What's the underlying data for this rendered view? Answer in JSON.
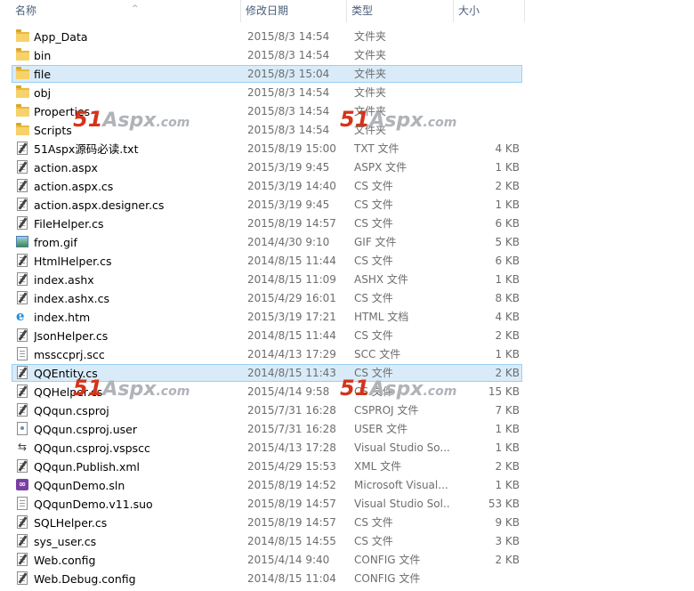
{
  "columns": {
    "name": "名称",
    "date": "修改日期",
    "type": "类型",
    "size": "大小"
  },
  "watermark": {
    "num": "51",
    "txt": "Aspx",
    "com": ".com"
  },
  "rows": [
    {
      "name": "App_Data",
      "date": "2015/8/3 14:54",
      "type": "文件夹",
      "size": "",
      "icon": "folder-icon",
      "selected": false
    },
    {
      "name": "bin",
      "date": "2015/8/3 14:54",
      "type": "文件夹",
      "size": "",
      "icon": "folder-icon",
      "selected": false
    },
    {
      "name": "file",
      "date": "2015/8/3 15:04",
      "type": "文件夹",
      "size": "",
      "icon": "folder-icon",
      "selected": true
    },
    {
      "name": "obj",
      "date": "2015/8/3 14:54",
      "type": "文件夹",
      "size": "",
      "icon": "folder-icon",
      "selected": false
    },
    {
      "name": "Properties",
      "date": "2015/8/3 14:54",
      "type": "文件夹",
      "size": "",
      "icon": "folder-icon",
      "selected": false
    },
    {
      "name": "Scripts",
      "date": "2015/8/3 14:54",
      "type": "文件夹",
      "size": "",
      "icon": "folder-icon",
      "selected": false
    },
    {
      "name": "51Aspx源码必读.txt",
      "date": "2015/8/19 15:00",
      "type": "TXT 文件",
      "size": "4 KB",
      "icon": "text-file-icon",
      "selected": false
    },
    {
      "name": "action.aspx",
      "date": "2015/3/19 9:45",
      "type": "ASPX 文件",
      "size": "1 KB",
      "icon": "text-file-icon",
      "selected": false
    },
    {
      "name": "action.aspx.cs",
      "date": "2015/3/19 14:40",
      "type": "CS 文件",
      "size": "2 KB",
      "icon": "text-file-icon",
      "selected": false
    },
    {
      "name": "action.aspx.designer.cs",
      "date": "2015/3/19 9:45",
      "type": "CS 文件",
      "size": "1 KB",
      "icon": "text-file-icon",
      "selected": false
    },
    {
      "name": "FileHelper.cs",
      "date": "2015/8/19 14:57",
      "type": "CS 文件",
      "size": "6 KB",
      "icon": "text-file-icon",
      "selected": false
    },
    {
      "name": "from.gif",
      "date": "2014/4/30 9:10",
      "type": "GIF 文件",
      "size": "5 KB",
      "icon": "image-file-icon",
      "selected": false
    },
    {
      "name": "HtmlHelper.cs",
      "date": "2014/8/15 11:44",
      "type": "CS 文件",
      "size": "6 KB",
      "icon": "text-file-icon",
      "selected": false
    },
    {
      "name": "index.ashx",
      "date": "2014/8/15 11:09",
      "type": "ASHX 文件",
      "size": "1 KB",
      "icon": "text-file-icon",
      "selected": false
    },
    {
      "name": "index.ashx.cs",
      "date": "2015/4/29 16:01",
      "type": "CS 文件",
      "size": "8 KB",
      "icon": "text-file-icon",
      "selected": false
    },
    {
      "name": "index.htm",
      "date": "2015/3/19 17:21",
      "type": "HTML 文档",
      "size": "4 KB",
      "icon": "ie-html-icon",
      "selected": false
    },
    {
      "name": "JsonHelper.cs",
      "date": "2014/8/15 11:44",
      "type": "CS 文件",
      "size": "2 KB",
      "icon": "text-file-icon",
      "selected": false
    },
    {
      "name": "mssccprj.scc",
      "date": "2014/4/13 17:29",
      "type": "SCC 文件",
      "size": "1 KB",
      "icon": "blank-file-icon",
      "selected": false
    },
    {
      "name": "QQEntity.cs",
      "date": "2014/8/15 11:43",
      "type": "CS 文件",
      "size": "2 KB",
      "icon": "text-file-icon",
      "selected": true
    },
    {
      "name": "QQHelper.cs",
      "date": "2015/4/14 9:58",
      "type": "CS 文件",
      "size": "15 KB",
      "icon": "text-file-icon",
      "selected": false
    },
    {
      "name": "QQqun.csproj",
      "date": "2015/7/31 16:28",
      "type": "CSPROJ 文件",
      "size": "7 KB",
      "icon": "text-file-icon",
      "selected": false
    },
    {
      "name": "QQqun.csproj.user",
      "date": "2015/7/31 16:28",
      "type": "USER 文件",
      "size": "1 KB",
      "icon": "user-file-icon",
      "selected": false
    },
    {
      "name": "QQqun.csproj.vspscc",
      "date": "2015/4/13 17:28",
      "type": "Visual Studio So...",
      "size": "1 KB",
      "icon": "vspscc-icon",
      "selected": false
    },
    {
      "name": "QQqun.Publish.xml",
      "date": "2015/4/29 15:53",
      "type": "XML 文件",
      "size": "2 KB",
      "icon": "text-file-icon",
      "selected": false
    },
    {
      "name": "QQqunDemo.sln",
      "date": "2015/8/19 14:52",
      "type": "Microsoft Visual...",
      "size": "1 KB",
      "icon": "visual-studio-icon",
      "selected": false
    },
    {
      "name": "QQqunDemo.v11.suo",
      "date": "2015/8/19 14:57",
      "type": "Visual Studio Sol...",
      "size": "53 KB",
      "icon": "blank-file-icon",
      "selected": false
    },
    {
      "name": "SQLHelper.cs",
      "date": "2015/8/19 14:57",
      "type": "CS 文件",
      "size": "9 KB",
      "icon": "text-file-icon",
      "selected": false
    },
    {
      "name": "sys_user.cs",
      "date": "2014/8/15 14:55",
      "type": "CS 文件",
      "size": "3 KB",
      "icon": "text-file-icon",
      "selected": false
    },
    {
      "name": "Web.config",
      "date": "2015/4/14 9:40",
      "type": "CONFIG 文件",
      "size": "2 KB",
      "icon": "text-file-icon",
      "selected": false
    },
    {
      "name": "Web.Debug.config",
      "date": "2014/8/15 11:04",
      "type": "CONFIG 文件",
      "size": "",
      "icon": "text-file-icon",
      "selected": false
    }
  ]
}
